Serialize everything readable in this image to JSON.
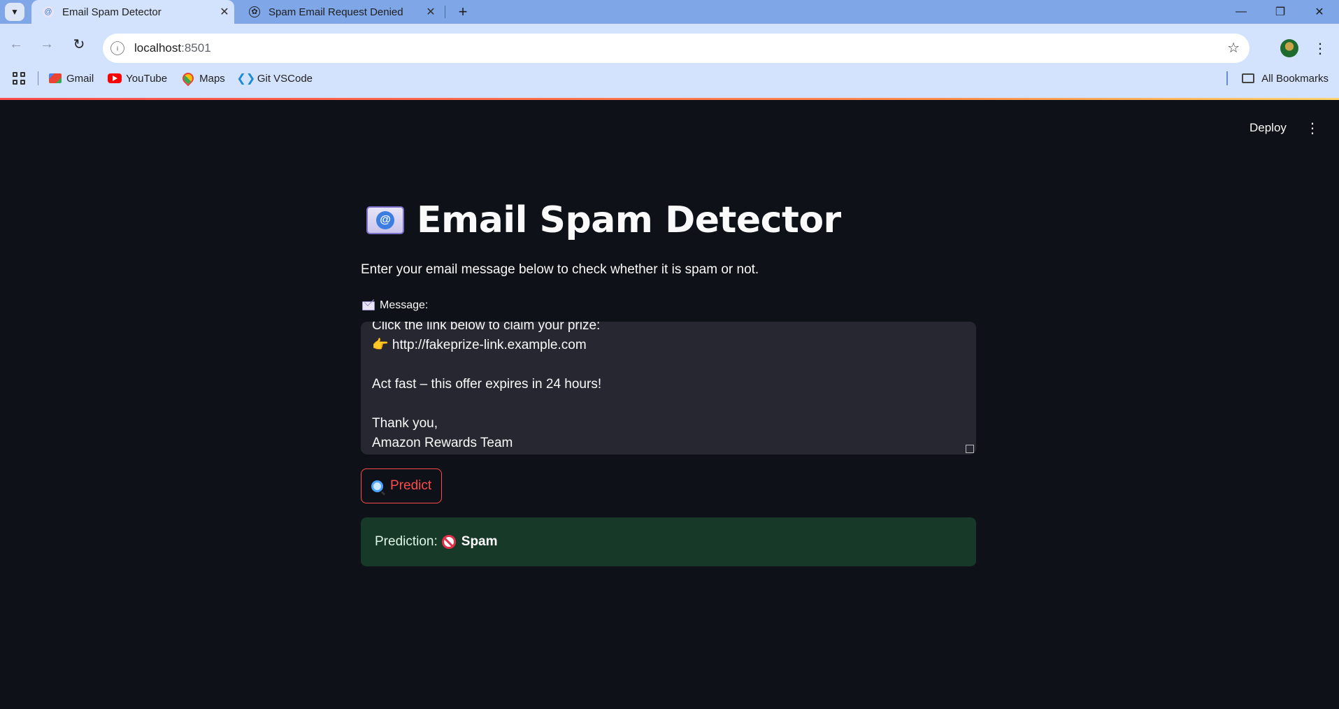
{
  "browser": {
    "tabs": [
      {
        "title": "Email Spam Detector",
        "active": true,
        "close": "✕"
      },
      {
        "title": "Spam Email Request Denied",
        "active": false,
        "close": "✕"
      }
    ],
    "new_tab": "+",
    "url_host": "localhost",
    "url_port": ":8501",
    "bookmarks": [
      {
        "label": "Gmail",
        "icon": "gmail-icon"
      },
      {
        "label": "YouTube",
        "icon": "youtube-icon"
      },
      {
        "label": "Maps",
        "icon": "maps-icon"
      },
      {
        "label": "Git VSCode",
        "icon": "vscode-icon"
      }
    ],
    "all_bookmarks": "All Bookmarks"
  },
  "app": {
    "deploy_label": "Deploy",
    "title": "Email Spam Detector",
    "title_icon": "email-icon",
    "subtitle": "Enter your email message below to check whether it is spam or not.",
    "message_label": "Message:",
    "message_text": "Click the link below to claim your prize:\n👉 http://fakeprize-link.example.com\n\nAct fast – this offer expires in 24 hours!\n\nThank you,\nAmazon Rewards Team",
    "predict_label": "Predict",
    "result_prefix": "Prediction:",
    "result_value": "Spam",
    "result_colors": {
      "background": "#173928",
      "text": "#dff5e5"
    },
    "accent_color": "#ff4b4b"
  }
}
